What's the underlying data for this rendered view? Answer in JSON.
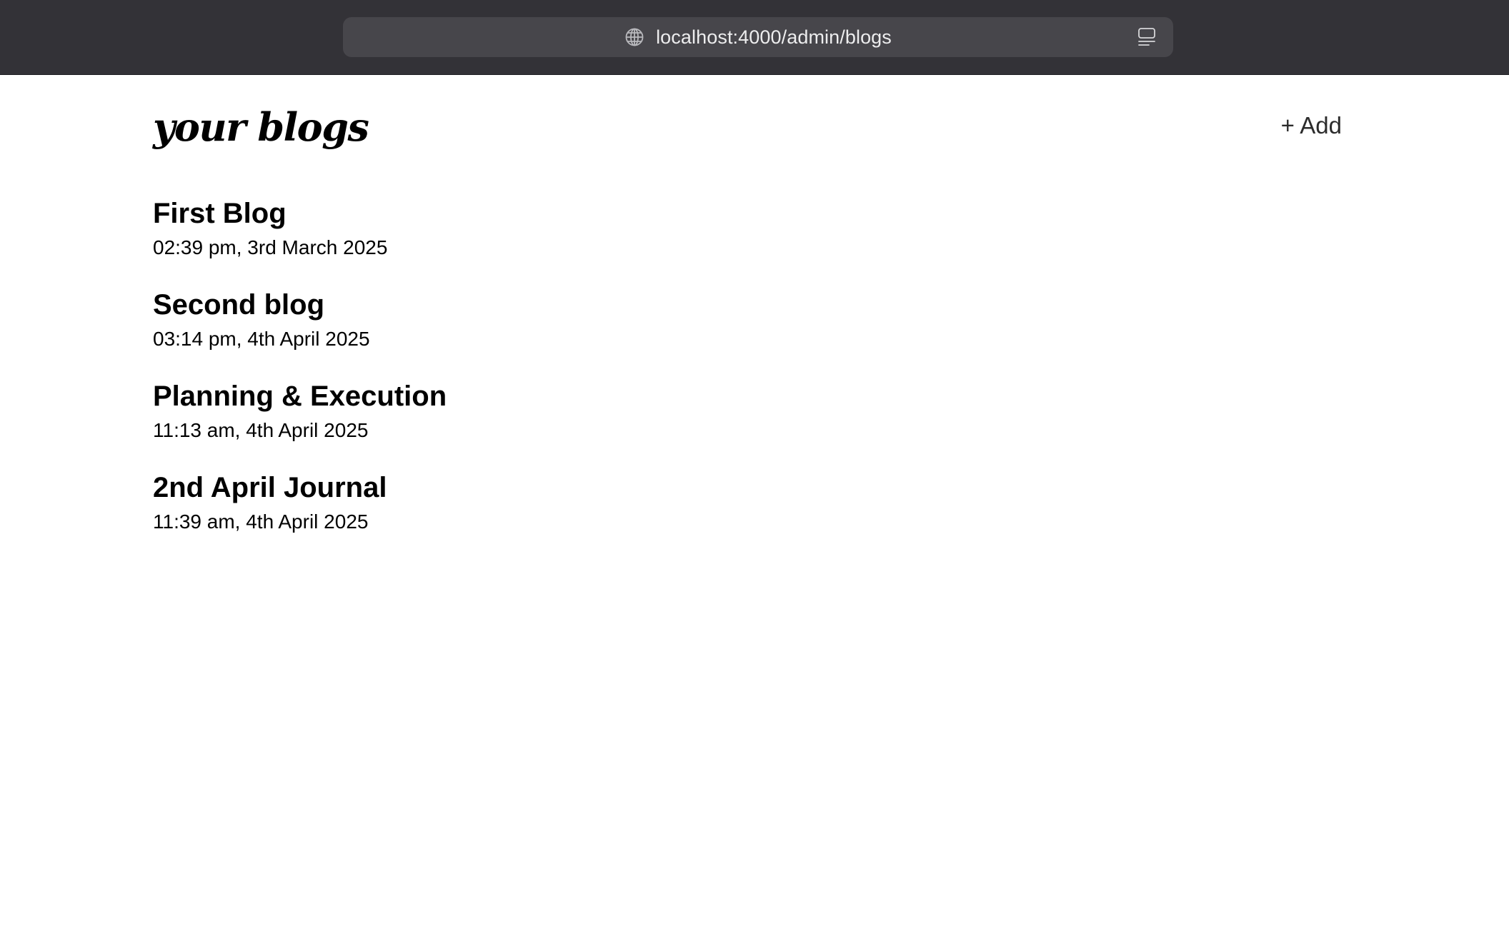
{
  "browser": {
    "url": "localhost:4000/admin/blogs",
    "icons": {
      "site": "globe-icon",
      "reader": "reader-view-icon"
    }
  },
  "header": {
    "title": "your blogs",
    "add_label": "+ Add"
  },
  "blogs": [
    {
      "title": "First Blog",
      "date": "02:39 pm, 3rd March 2025"
    },
    {
      "title": "Second blog",
      "date": "03:14 pm, 4th April 2025"
    },
    {
      "title": "Planning & Execution",
      "date": "11:13 am, 4th April 2025"
    },
    {
      "title": "2nd April Journal",
      "date": "11:39 am, 4th April 2025"
    }
  ],
  "colors": {
    "toolbar_bg": "#333237",
    "address_bar_bg": "#47464b",
    "page_bg": "#ffffff",
    "text": "#000000"
  }
}
